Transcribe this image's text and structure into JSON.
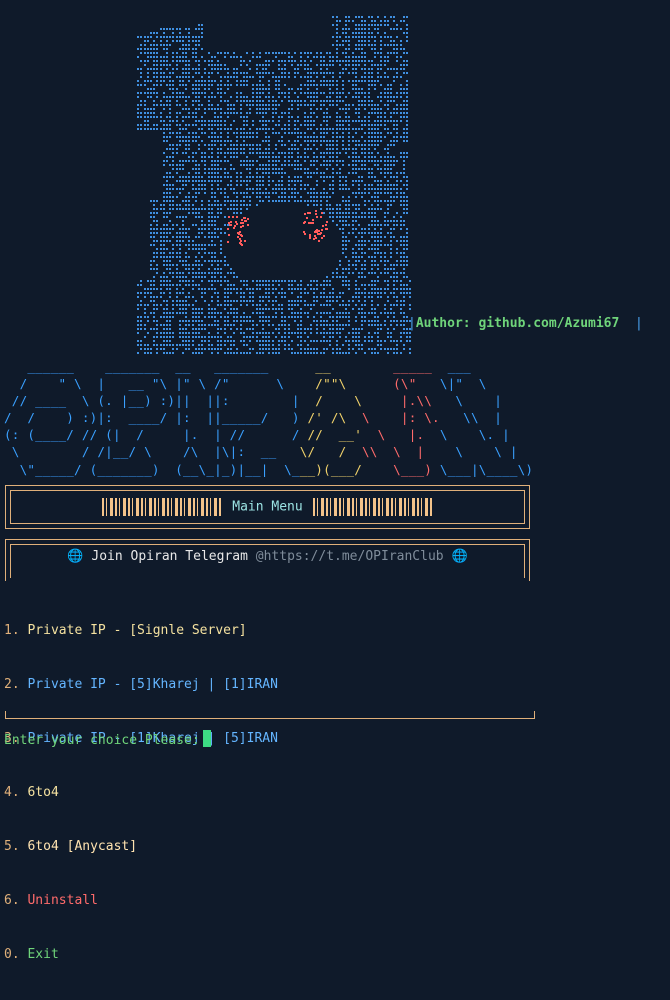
{
  "author": {
    "label": "Author: github.com/Azumi67"
  },
  "banner_lines": [
    "   ______    _______  __   _______      __        _____  ___",
    "  /    \" \\  |   __ \"\\ |\" \\ /\"      \\    /\"\"\\      (\\\"   \\|\"  \\",
    " // ____  \\ (. |__) :)||  ||:        |  /    \\     |.\\\\   \\    |",
    "/  /    ) :)|:  ____/ |:  ||_____/   ) /' /\\  \\    |: \\.   \\\\  |",
    "(: (____/ // (|  /     |.  | //      / //  __'  \\   |.  \\    \\. |",
    " \\        / /|__/ \\    /\\  |\\|:  __   \\/   /  \\\\  \\  |    \\    \\ |",
    "  \\\"_____/ (_______)  (__\\_|_)|__|  \\___)(___/    \\___) \\___|\\____\\)"
  ],
  "menu": {
    "title": "Main Menu"
  },
  "telegram": {
    "label": "Join Opiran Telegram",
    "url": "@https://t.me/OPIranClub"
  },
  "items": [
    {
      "num": "1.",
      "label": "Private IP - [Signle Server]"
    },
    {
      "num": "2.",
      "label": "Private IP - [5]Kharej | [1]IRAN"
    },
    {
      "num": "3.",
      "label": "Private IP - [1]Kharej | [5]IRAN"
    },
    {
      "num": "4.",
      "label": "6to4"
    },
    {
      "num": "5.",
      "label": "6to4 [Anycast]"
    },
    {
      "num": "6.",
      "label": "Uninstall"
    },
    {
      "num": "0.",
      "label": "Exit"
    }
  ],
  "prompt": {
    "label": "Enter your choice Please:"
  },
  "colors": {
    "bg": "#0f1a2a",
    "border": "#e0b07a",
    "blue": "#3aa0ff",
    "yellow": "#f2d36b",
    "red": "#ff6b6b",
    "green": "#6fd47a"
  }
}
